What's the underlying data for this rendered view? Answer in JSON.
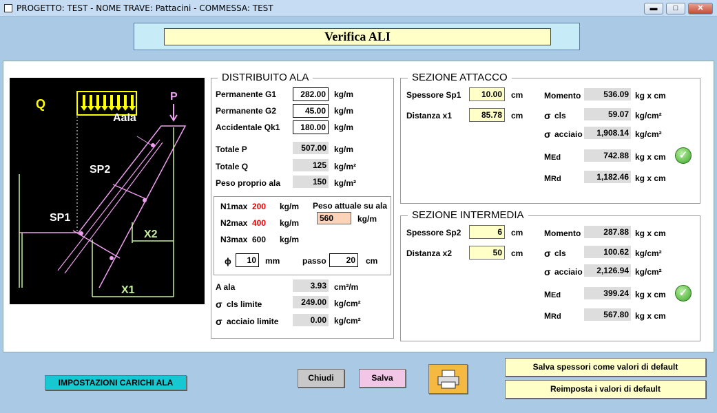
{
  "window": {
    "title": "PROGETTO: TEST - NOME TRAVE: Pattacini - COMMESSA: TEST",
    "min_glyph": "▬",
    "max_glyph": "□",
    "close_glyph": "✕"
  },
  "banner": {
    "title": "Verifica ALI"
  },
  "figure": {
    "q": "Q",
    "p": "P",
    "aala": "Aala",
    "sp2": "SP2",
    "sp1": "SP1",
    "x2": "X2",
    "x1": "X1"
  },
  "distribuito": {
    "title": "DISTRIBUITO ALA",
    "g1": {
      "label": "Permanente G1",
      "value": "282.00",
      "unit": "kg/m"
    },
    "g2": {
      "label": "Permanente G2",
      "value": "45.00",
      "unit": "kg/m"
    },
    "qk1": {
      "label": "Accidentale Qk1",
      "value": "180.00",
      "unit": "kg/m"
    },
    "totp": {
      "label": "Totale P",
      "value": "507.00",
      "unit": "kg/m"
    },
    "totq": {
      "label": "Totale Q",
      "value": "125",
      "unit": "kg/m²"
    },
    "peso": {
      "label": "Peso proprio ala",
      "value": "150",
      "unit": "kg/m²"
    },
    "n1": {
      "label": "N1max",
      "value": "200",
      "unit": "kg/m"
    },
    "n2": {
      "label": "N2max",
      "value": "400",
      "unit": "kg/m"
    },
    "n3": {
      "label": "N3max",
      "value": "600",
      "unit": "kg/m"
    },
    "peso_attuale": {
      "label": "Peso attuale su ala",
      "value": "560",
      "unit": "kg/m"
    },
    "phi": {
      "symbol": "ɸ",
      "value": "10",
      "unit": "mm"
    },
    "passo": {
      "label": "passo",
      "value": "20",
      "unit": "cm"
    },
    "aala": {
      "label": "A ala",
      "value": "3.93",
      "unit": "cm²/m"
    },
    "cls_lim": {
      "sym": "σ",
      "label": "cls limite",
      "value": "249.00",
      "unit": "kg/cm²"
    },
    "acc_lim": {
      "sym": "σ",
      "label": "acciaio limite",
      "value": "0.00",
      "unit": "kg/cm²"
    }
  },
  "attacco": {
    "title": "SEZIONE ATTACCO",
    "sp1": {
      "label": "Spessore Sp1",
      "value": "10.00",
      "unit": "cm"
    },
    "x1": {
      "label": "Distanza x1",
      "value": "85.78",
      "unit": "cm"
    },
    "momento": {
      "label": "Momento",
      "value": "536.09",
      "unit": "kg x cm"
    },
    "cls": {
      "sym": "σ",
      "label": "cls",
      "value": "59.07",
      "unit": "kg/cm²"
    },
    "acciaio": {
      "sym": "σ",
      "label": "acciaio",
      "value": "1,908.14",
      "unit": "kg/cm²"
    },
    "med": {
      "m": "M",
      "sub": "Ed",
      "value": "742.88",
      "unit": "kg x cm"
    },
    "mrd": {
      "m": "M",
      "sub": "Rd",
      "value": "1,182.46",
      "unit": "kg x cm"
    }
  },
  "intermedia": {
    "title": "SEZIONE INTERMEDIA",
    "sp2": {
      "label": "Spessore Sp2",
      "value": "6",
      "unit": "cm"
    },
    "x2": {
      "label": "Distanza x2",
      "value": "50",
      "unit": "cm"
    },
    "momento": {
      "label": "Momento",
      "value": "287.88",
      "unit": "kg x cm"
    },
    "cls": {
      "sym": "σ",
      "label": "cls",
      "value": "100.62",
      "unit": "kg/cm²"
    },
    "acciaio": {
      "sym": "σ",
      "label": "acciaio",
      "value": "2,126.94",
      "unit": "kg/cm²"
    },
    "med": {
      "m": "M",
      "sub": "Ed",
      "value": "399.24",
      "unit": "kg x cm"
    },
    "mrd": {
      "m": "M",
      "sub": "Rd",
      "value": "567.80",
      "unit": "kg x cm"
    }
  },
  "buttons": {
    "impostazioni": "IMPOSTAZIONI CARICHI ALA",
    "chiudi": "Chiudi",
    "salva": "Salva",
    "salva_default": "Salva spessori come valori di default",
    "reimposta": "Reimposta i valori di default"
  },
  "colors": {
    "accent_red": "#e00000",
    "check_green": "#3da42a",
    "figure_pink": "#f0a0f0",
    "figure_green": "#c8f0a0"
  }
}
